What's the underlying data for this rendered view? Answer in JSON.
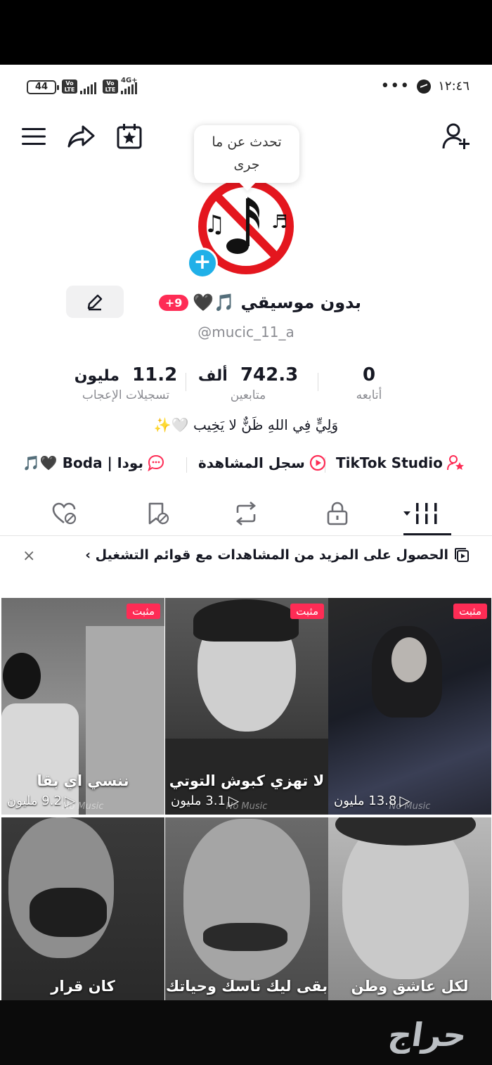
{
  "status_bar": {
    "battery": "44",
    "network": "4G+",
    "time": "١٢:٤٦",
    "dots": "•••"
  },
  "bubble": {
    "text_line1": "تحدث عن ما",
    "text_line2": "جرى"
  },
  "profile": {
    "name": "بدون موسيقي 🎵🖤",
    "badge": "+9",
    "handle": "@mucic_11_a",
    "bio": "وَلِيٍّ فِي اللهِ ظَنٌّ لا يَخِيب 🤍✨"
  },
  "stats": {
    "following": {
      "value": "0",
      "label": "أتابعه"
    },
    "followers": {
      "value": "742.3",
      "unit": "ألف",
      "label": "متابعين"
    },
    "likes": {
      "value": "11.2",
      "unit": "مليون",
      "label": "تسجيلات الإعجاب"
    }
  },
  "links": {
    "studio": "TikTok Studio",
    "history": "سجل المشاهدة",
    "boda": "بودا | Boda 🖤🎵"
  },
  "banner": {
    "text": "الحصول على المزيد من المشاهدات مع قوائم التشغيل ›",
    "close": "×"
  },
  "videos": [
    {
      "pinned": "مثبت",
      "caption": "ننسي اي بقا",
      "views": "9.2 مليون",
      "watermark": "No Music"
    },
    {
      "pinned": "مثبت",
      "caption": "لا تهزي كبوش التوتي",
      "views": "3.1 مليون",
      "watermark": "No Music"
    },
    {
      "pinned": "مثبت",
      "caption": "",
      "views": "13.8 مليون",
      "watermark": "No Music"
    },
    {
      "pinned": "",
      "caption": "كان قرار",
      "views": "",
      "watermark": ""
    },
    {
      "pinned": "",
      "caption": "بقى ليك ناسك وحياتك",
      "views": "",
      "watermark": ""
    },
    {
      "pinned": "",
      "caption": "لكل عاشق وطن",
      "views": "",
      "watermark": ""
    }
  ],
  "watermark_site": "حراج",
  "colors": {
    "accent": "#fe2c55",
    "plus": "#20b0e8",
    "text": "#161823",
    "muted": "#8a8b91"
  }
}
